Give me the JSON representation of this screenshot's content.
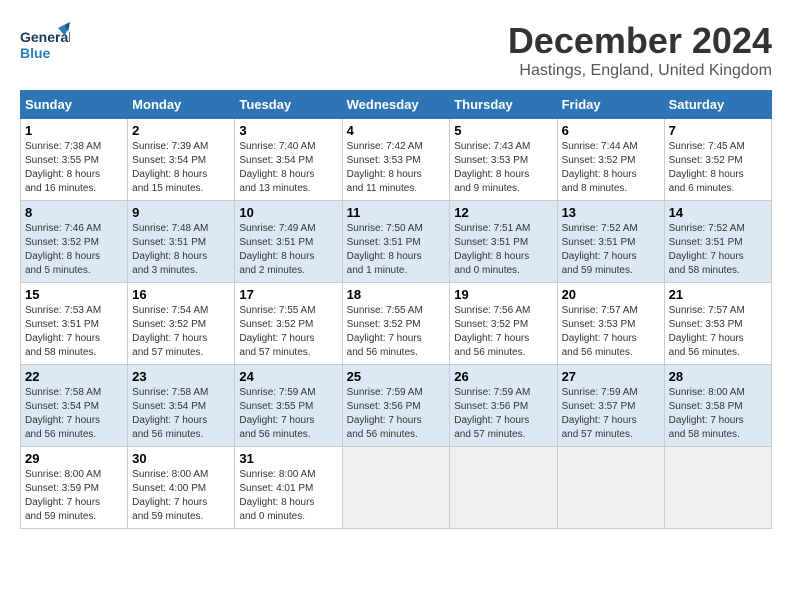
{
  "header": {
    "logo_general": "General",
    "logo_blue": "Blue",
    "main_title": "December 2024",
    "subtitle": "Hastings, England, United Kingdom"
  },
  "calendar": {
    "days_of_week": [
      "Sunday",
      "Monday",
      "Tuesday",
      "Wednesday",
      "Thursday",
      "Friday",
      "Saturday"
    ],
    "weeks": [
      [
        {
          "day": "",
          "info": ""
        },
        {
          "day": "2",
          "info": "Sunrise: 7:39 AM\nSunset: 3:54 PM\nDaylight: 8 hours\nand 15 minutes."
        },
        {
          "day": "3",
          "info": "Sunrise: 7:40 AM\nSunset: 3:54 PM\nDaylight: 8 hours\nand 13 minutes."
        },
        {
          "day": "4",
          "info": "Sunrise: 7:42 AM\nSunset: 3:53 PM\nDaylight: 8 hours\nand 11 minutes."
        },
        {
          "day": "5",
          "info": "Sunrise: 7:43 AM\nSunset: 3:53 PM\nDaylight: 8 hours\nand 9 minutes."
        },
        {
          "day": "6",
          "info": "Sunrise: 7:44 AM\nSunset: 3:52 PM\nDaylight: 8 hours\nand 8 minutes."
        },
        {
          "day": "7",
          "info": "Sunrise: 7:45 AM\nSunset: 3:52 PM\nDaylight: 8 hours\nand 6 minutes."
        }
      ],
      [
        {
          "day": "1",
          "info": "Sunrise: 7:38 AM\nSunset: 3:55 PM\nDaylight: 8 hours\nand 16 minutes."
        },
        {
          "day": "9",
          "info": "Sunrise: 7:48 AM\nSunset: 3:51 PM\nDaylight: 8 hours\nand 3 minutes."
        },
        {
          "day": "10",
          "info": "Sunrise: 7:49 AM\nSunset: 3:51 PM\nDaylight: 8 hours\nand 2 minutes."
        },
        {
          "day": "11",
          "info": "Sunrise: 7:50 AM\nSunset: 3:51 PM\nDaylight: 8 hours\nand 1 minute."
        },
        {
          "day": "12",
          "info": "Sunrise: 7:51 AM\nSunset: 3:51 PM\nDaylight: 8 hours\nand 0 minutes."
        },
        {
          "day": "13",
          "info": "Sunrise: 7:52 AM\nSunset: 3:51 PM\nDaylight: 7 hours\nand 59 minutes."
        },
        {
          "day": "14",
          "info": "Sunrise: 7:52 AM\nSunset: 3:51 PM\nDaylight: 7 hours\nand 58 minutes."
        }
      ],
      [
        {
          "day": "8",
          "info": "Sunrise: 7:46 AM\nSunset: 3:52 PM\nDaylight: 8 hours\nand 5 minutes."
        },
        {
          "day": "16",
          "info": "Sunrise: 7:54 AM\nSunset: 3:52 PM\nDaylight: 7 hours\nand 57 minutes."
        },
        {
          "day": "17",
          "info": "Sunrise: 7:55 AM\nSunset: 3:52 PM\nDaylight: 7 hours\nand 57 minutes."
        },
        {
          "day": "18",
          "info": "Sunrise: 7:55 AM\nSunset: 3:52 PM\nDaylight: 7 hours\nand 56 minutes."
        },
        {
          "day": "19",
          "info": "Sunrise: 7:56 AM\nSunset: 3:52 PM\nDaylight: 7 hours\nand 56 minutes."
        },
        {
          "day": "20",
          "info": "Sunrise: 7:57 AM\nSunset: 3:53 PM\nDaylight: 7 hours\nand 56 minutes."
        },
        {
          "day": "21",
          "info": "Sunrise: 7:57 AM\nSunset: 3:53 PM\nDaylight: 7 hours\nand 56 minutes."
        }
      ],
      [
        {
          "day": "15",
          "info": "Sunrise: 7:53 AM\nSunset: 3:51 PM\nDaylight: 7 hours\nand 58 minutes."
        },
        {
          "day": "23",
          "info": "Sunrise: 7:58 AM\nSunset: 3:54 PM\nDaylight: 7 hours\nand 56 minutes."
        },
        {
          "day": "24",
          "info": "Sunrise: 7:59 AM\nSunset: 3:55 PM\nDaylight: 7 hours\nand 56 minutes."
        },
        {
          "day": "25",
          "info": "Sunrise: 7:59 AM\nSunset: 3:56 PM\nDaylight: 7 hours\nand 56 minutes."
        },
        {
          "day": "26",
          "info": "Sunrise: 7:59 AM\nSunset: 3:56 PM\nDaylight: 7 hours\nand 57 minutes."
        },
        {
          "day": "27",
          "info": "Sunrise: 7:59 AM\nSunset: 3:57 PM\nDaylight: 7 hours\nand 57 minutes."
        },
        {
          "day": "28",
          "info": "Sunrise: 8:00 AM\nSunset: 3:58 PM\nDaylight: 7 hours\nand 58 minutes."
        }
      ],
      [
        {
          "day": "22",
          "info": "Sunrise: 7:58 AM\nSunset: 3:54 PM\nDaylight: 7 hours\nand 56 minutes."
        },
        {
          "day": "30",
          "info": "Sunrise: 8:00 AM\nSunset: 4:00 PM\nDaylight: 7 hours\nand 59 minutes."
        },
        {
          "day": "31",
          "info": "Sunrise: 8:00 AM\nSunset: 4:01 PM\nDaylight: 8 hours\nand 0 minutes."
        },
        {
          "day": "",
          "info": ""
        },
        {
          "day": "",
          "info": ""
        },
        {
          "day": "",
          "info": ""
        },
        {
          "day": "",
          "info": ""
        }
      ],
      [
        {
          "day": "29",
          "info": "Sunrise: 8:00 AM\nSunset: 3:59 PM\nDaylight: 7 hours\nand 59 minutes."
        },
        {
          "day": "",
          "info": ""
        },
        {
          "day": "",
          "info": ""
        },
        {
          "day": "",
          "info": ""
        },
        {
          "day": "",
          "info": ""
        },
        {
          "day": "",
          "info": ""
        },
        {
          "day": "",
          "info": ""
        }
      ]
    ]
  }
}
